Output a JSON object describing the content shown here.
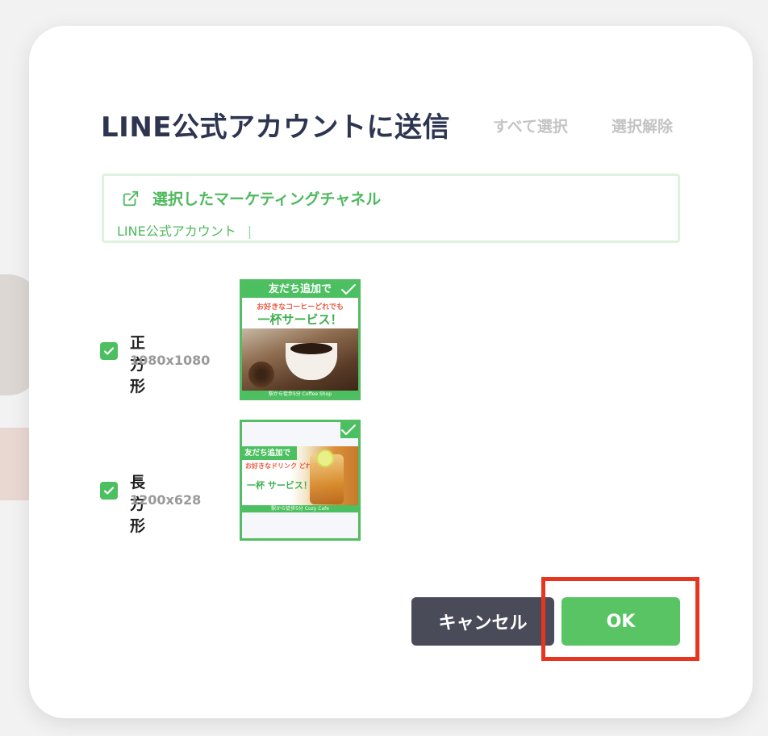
{
  "dialog": {
    "title": "LINE公式アカウントに送信",
    "select_all_label": "すべて選択",
    "deselect_label": "選択解除"
  },
  "channel": {
    "heading": "選択したマーケティングチャネル",
    "value": "LINE公式アカウント",
    "separator": "|"
  },
  "formats": [
    {
      "name": "正方形",
      "size": "1080x1080",
      "checked": true,
      "thumbnail": {
        "selected": true,
        "headline": "友だち追加で",
        "subline": "お好きなコーヒーどれでも",
        "main": "一杯サービス！",
        "footer": "駅から徒歩5分 Coffee Shop"
      }
    },
    {
      "name": "長方形",
      "size": "1200x628",
      "checked": true,
      "thumbnail": {
        "selected": true,
        "headline": "友だち追加で",
        "subline": "お好きなドリンク どれでも",
        "main": "一杯 サービス！",
        "footer": "駅から徒歩5分 Cozy Cafe"
      }
    }
  ],
  "buttons": {
    "cancel": "キャンセル",
    "ok": "OK"
  },
  "colors": {
    "accent_green": "#4cc060",
    "ok_button": "#58c464",
    "cancel_button": "#4a4b59",
    "title": "#2d3550",
    "highlight": "#e8351f"
  },
  "icons": {
    "channel": "external-link-icon",
    "checkbox": "checkmark-icon",
    "thumb_selected": "check-icon"
  }
}
